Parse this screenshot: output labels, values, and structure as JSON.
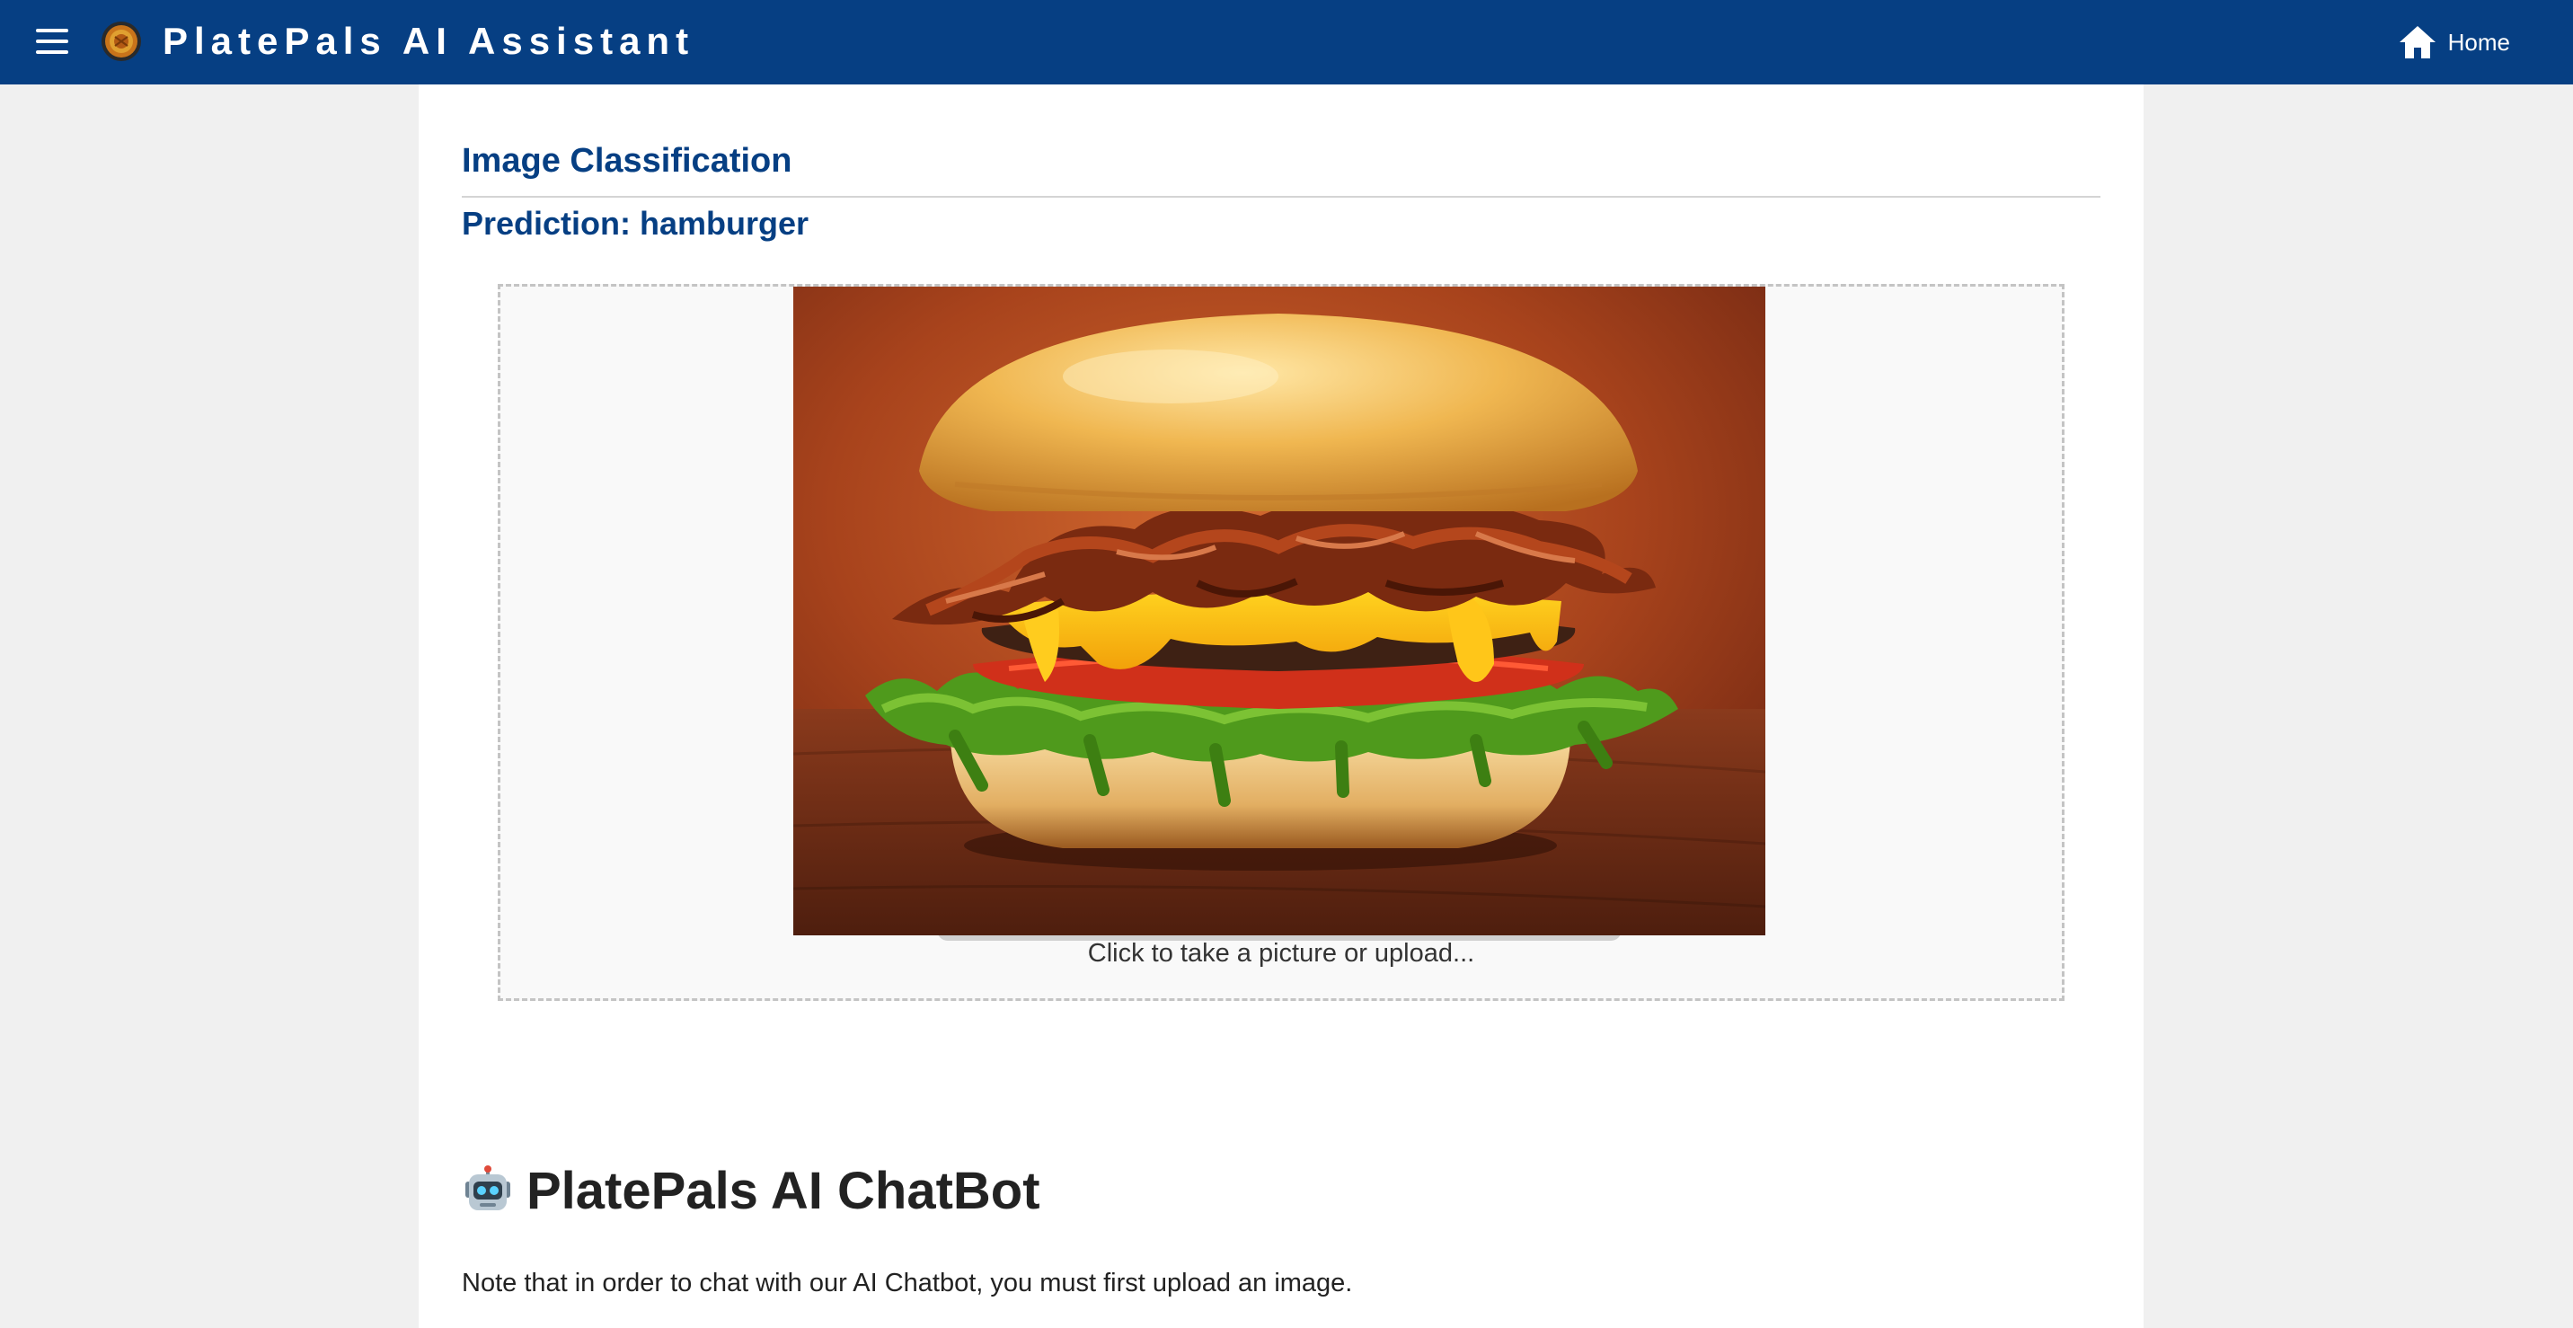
{
  "header": {
    "app_title": "PlatePals AI Assistant",
    "menu_icon": "hamburger-menu-icon",
    "logo_icon": "platepals-logo-icon",
    "home_icon": "home-icon",
    "home_label": "Home",
    "bar_color": "#063f83"
  },
  "classification": {
    "title": "Image Classification",
    "prediction": "Prediction: hamburger",
    "image_subject": "hamburger",
    "upload_hint": "Click to take a picture or upload...",
    "accent_color": "#063f83"
  },
  "chatbot": {
    "icon": "robot-icon",
    "title": "PlatePals AI ChatBot",
    "note": "Note that in order to chat with our AI Chatbot, you must first upload an image."
  }
}
